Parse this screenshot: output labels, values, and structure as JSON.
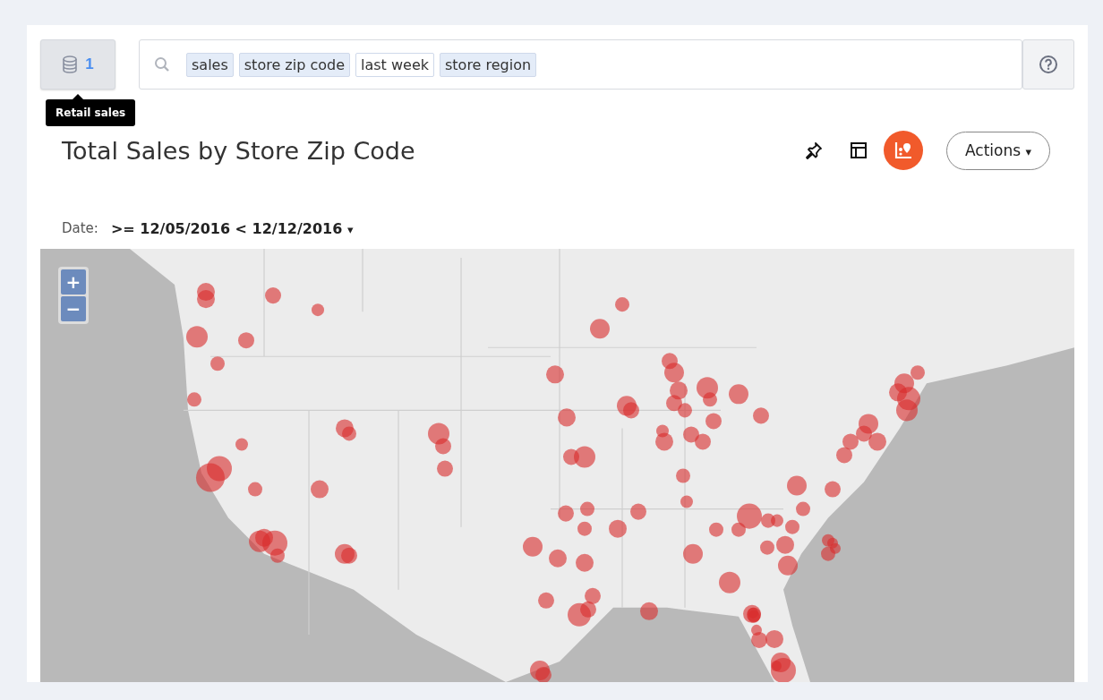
{
  "source_button": {
    "count": "1",
    "tooltip": "Retail sales"
  },
  "search": {
    "tokens": [
      {
        "text": "sales",
        "kind": "column"
      },
      {
        "text": "store zip code",
        "kind": "column"
      },
      {
        "text": "last week",
        "kind": "keyword"
      },
      {
        "text": "store region",
        "kind": "column"
      }
    ]
  },
  "title": "Total Sales by Store Zip Code",
  "views": [
    {
      "kind": "pin",
      "selected": false
    },
    {
      "kind": "table",
      "selected": false
    },
    {
      "kind": "map",
      "selected": true
    }
  ],
  "actions_button": {
    "label": "Actions",
    "caret": "▾"
  },
  "filter": {
    "label": "Date:",
    "value": ">= 12/05/2016 < 12/12/2016",
    "caret": "▾"
  },
  "map": {
    "zoom_in": "+",
    "zoom_out": "−"
  }
}
